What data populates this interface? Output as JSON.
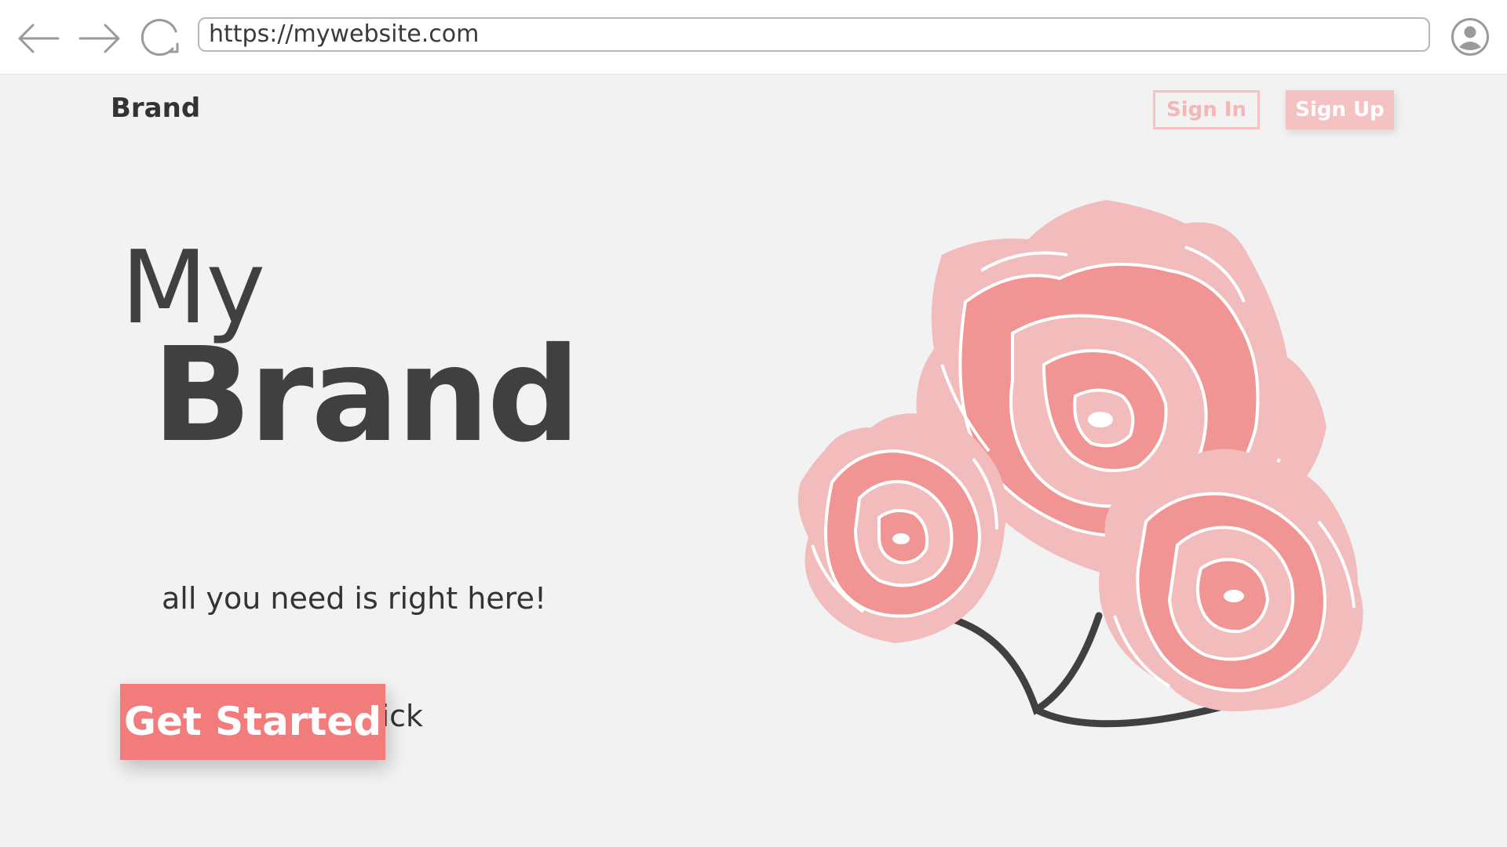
{
  "browser": {
    "url": "https://mywebsite.com",
    "icons": [
      "back-arrow-icon",
      "forward-arrow-icon",
      "reload-icon",
      "user-profile-icon"
    ]
  },
  "header": {
    "brand": "Brand",
    "sign_in_label": "Sign In",
    "sign_up_label": "Sign Up"
  },
  "hero": {
    "title_line1": "My",
    "title_line2": "Brand",
    "tagline_line1": "all you need is right here!",
    "tagline_line2": "with one single click",
    "cta_label": "Get Started",
    "illustration": "roses-illustration"
  },
  "colors": {
    "background": "#f2f2f2",
    "accent": "#f27c7c",
    "accent_light": "#f4c2c2",
    "rose_dark": "#f09494",
    "rose_light": "#f2bcbc",
    "text": "#404040"
  }
}
